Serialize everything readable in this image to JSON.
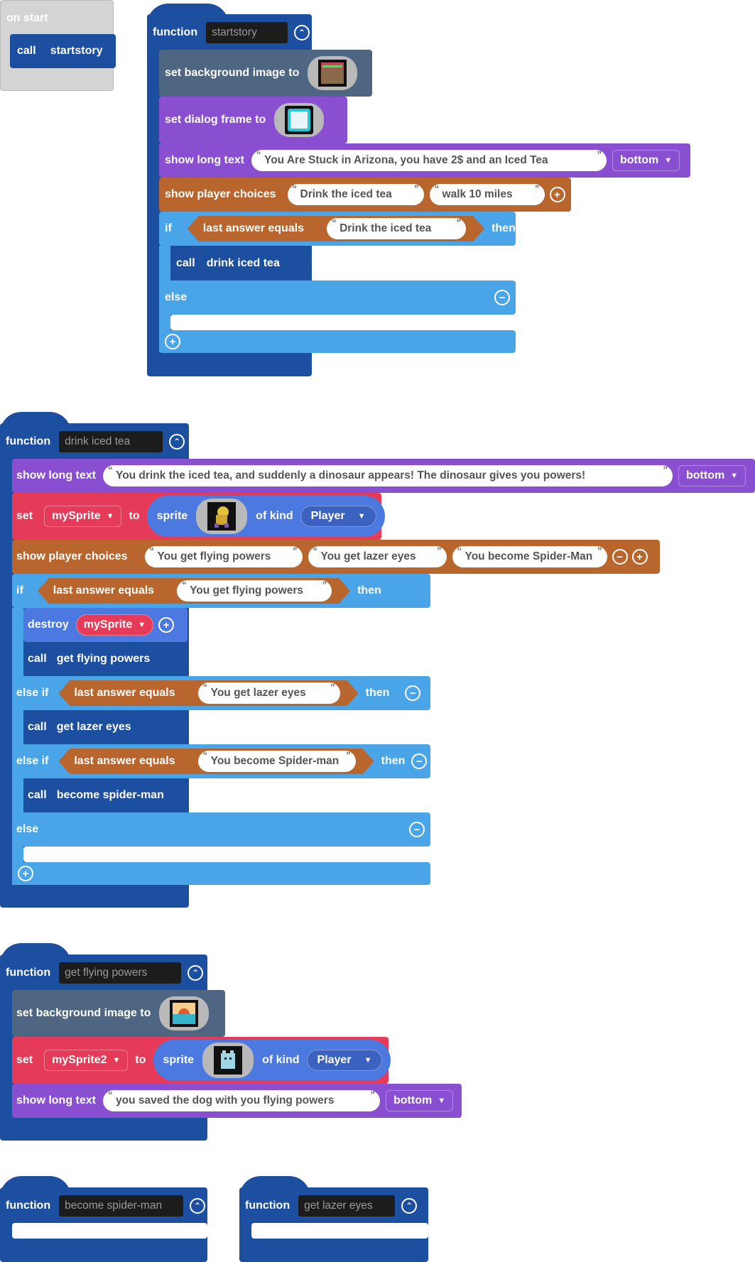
{
  "on_start": {
    "label": "on start",
    "call_label": "call",
    "call_target": "startstory"
  },
  "startstory": {
    "function_label": "function",
    "name": "startstory",
    "set_bg_label": "set background image to",
    "set_frame_label": "set dialog frame to",
    "show_long_text_label": "show long text",
    "long_text": "You Are Stuck in Arizona, you have 2$ and an Iced Tea",
    "position": "bottom",
    "show_choices_label": "show player choices",
    "choices": [
      "Drink the iced tea",
      "walk 10 miles"
    ],
    "if_label": "if",
    "last_answer_label": "last answer equals",
    "if_value": "Drink the iced tea",
    "then_label": "then",
    "call_label": "call",
    "call_target": "drink iced tea",
    "else_label": "else"
  },
  "drink_iced_tea": {
    "function_label": "function",
    "name": "drink iced tea",
    "show_long_text_label": "show long text",
    "long_text": "You drink the iced tea, and suddenly a dinosaur appears! The dinosaur gives you powers!",
    "position": "bottom",
    "set_label": "set",
    "var": "mySprite",
    "to_label": "to",
    "sprite_label": "sprite",
    "of_kind_label": "of kind",
    "kind": "Player",
    "show_choices_label": "show player choices",
    "choices": [
      "You get flying powers",
      "You get lazer eyes",
      "You become Spider-Man"
    ],
    "if_label": "if",
    "last_answer_label": "last answer equals",
    "if_value": "You get flying powers",
    "then_label": "then",
    "destroy_label": "destroy",
    "destroy_var": "mySprite",
    "call_label": "call",
    "call1": "get flying powers",
    "elseif_label": "else if",
    "elseif1_value": "You get lazer eyes",
    "call2": "get lazer eyes",
    "elseif2_value": "You become Spider-man",
    "call3": "become spider-man",
    "else_label": "else"
  },
  "get_flying_powers": {
    "function_label": "function",
    "name": "get flying powers",
    "set_bg_label": "set background image to",
    "set_label": "set",
    "var": "mySprite2",
    "to_label": "to",
    "sprite_label": "sprite",
    "of_kind_label": "of kind",
    "kind": "Player",
    "show_long_text_label": "show long text",
    "long_text": "you saved the dog with you flying powers",
    "position": "bottom"
  },
  "become_spider_man": {
    "function_label": "function",
    "name": "become spider-man"
  },
  "get_lazer_eyes": {
    "function_label": "function",
    "name": "get lazer eyes"
  },
  "colors": {
    "function": "#1d4fa0",
    "looks": "#4e6682",
    "story": "#8a4fd1",
    "choice": "#b8662d",
    "logic": "#4aa5e8",
    "sprite_var": "#e53b58",
    "sprite_round": "#4b79e0",
    "on_start": "#d4d4d4"
  }
}
